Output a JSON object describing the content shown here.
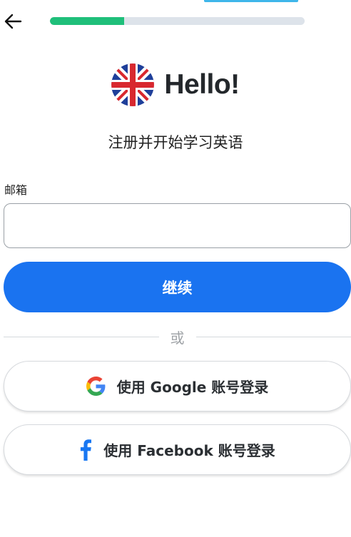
{
  "header": {
    "back_icon": "arrow-left-icon",
    "progress": 0.29,
    "progress_color": "#1fbf7a",
    "track_color": "#dde3ea"
  },
  "hero": {
    "flag_icon": "uk-flag-icon",
    "title": "Hello!"
  },
  "subtitle": "注册并开始学习英语",
  "email": {
    "label": "邮箱",
    "value": "",
    "placeholder": ""
  },
  "continue_button": {
    "label": "继续",
    "color": "#1a73f0"
  },
  "divider": {
    "text": "或"
  },
  "social": {
    "google": {
      "icon": "google-icon",
      "label": "使用 Google 账号登录"
    },
    "facebook": {
      "icon": "facebook-icon",
      "label": "使用 Facebook 账号登录",
      "color": "#1877f2"
    }
  }
}
